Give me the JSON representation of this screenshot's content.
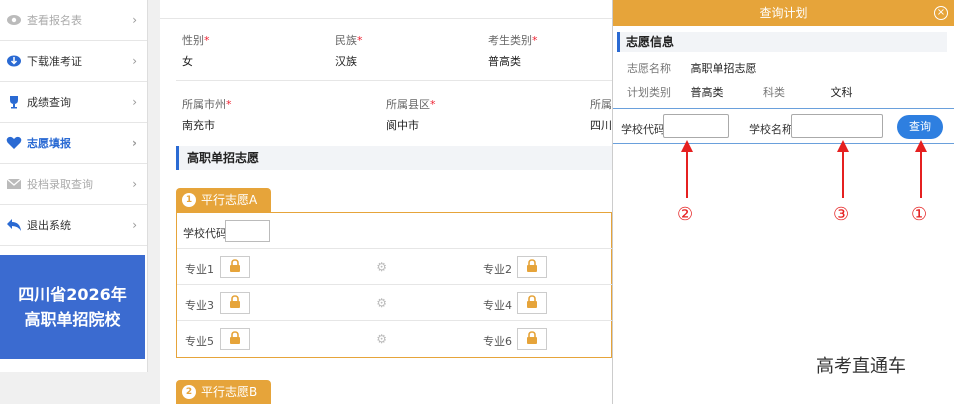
{
  "sidebar": {
    "items": [
      {
        "label": "查看报名表",
        "state": "disabled",
        "icon": "eye-icon"
      },
      {
        "label": "下载准考证",
        "state": "normal",
        "icon": "download-cloud-icon"
      },
      {
        "label": "成绩查询",
        "state": "normal",
        "icon": "trophy-icon"
      },
      {
        "label": "志愿填报",
        "state": "active",
        "icon": "heart-icon"
      },
      {
        "label": "投档录取查询",
        "state": "disabled",
        "icon": "mail-icon"
      },
      {
        "label": "退出系统",
        "state": "normal",
        "icon": "back-arrow-icon"
      }
    ],
    "promo_line1": "四川省2026年",
    "promo_line2": "高职单招院校"
  },
  "main": {
    "gender_label": "性别",
    "gender_value": "女",
    "ethnicity_label": "民族",
    "ethnicity_value": "汉族",
    "category_label": "考生类别",
    "category_value": "普高类",
    "city_label": "所属市州",
    "city_value": "南充市",
    "county_label": "所属县区",
    "county_value": "阆中市",
    "cut_label": "所属",
    "cut_value": "四川",
    "section_title": "高职单招志愿",
    "group_a": {
      "num": "1",
      "label": "平行志愿A",
      "school_code_label": "学校代码",
      "majors": [
        "专业1",
        "专业2",
        "专业3",
        "专业4",
        "专业5",
        "专业6"
      ]
    },
    "group_b": {
      "num": "2",
      "label": "平行志愿B"
    }
  },
  "panel": {
    "title": "查询计划",
    "close": "×",
    "info_title": "志愿信息",
    "name_label": "志愿名称",
    "name_value": "高职单招志愿",
    "plan_type_label": "计划类别",
    "plan_type_value": "普高类",
    "subject_label": "科类",
    "subject_value": "文科",
    "school_code_label": "学校代码",
    "school_name_label": "学校名称",
    "query_button": "查询",
    "annotations": [
      "②",
      "③",
      "①"
    ]
  },
  "watermark": "高考直通车",
  "colors": {
    "accent_orange": "#e6a43a",
    "primary_blue": "#2a6ad3",
    "promo_blue": "#3b6bd0",
    "arrow_red": "#e52020"
  }
}
